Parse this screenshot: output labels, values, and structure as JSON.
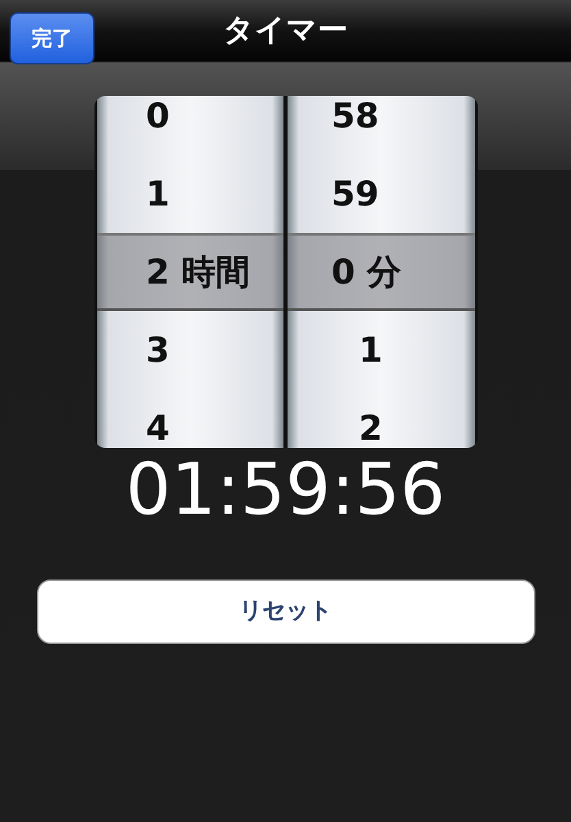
{
  "navbar": {
    "title": "タイマー",
    "done_button": "完了"
  },
  "picker": {
    "columns": [
      {
        "unit": "時間",
        "items": [
          {
            "text": "0",
            "selected": false
          },
          {
            "text": "1",
            "selected": false
          },
          {
            "text": "2",
            "selected": true
          },
          {
            "text": "3",
            "selected": false
          },
          {
            "text": "4",
            "selected": false
          }
        ]
      },
      {
        "unit": "分",
        "items": [
          {
            "text": "58",
            "selected": false
          },
          {
            "text": "59",
            "selected": false
          },
          {
            "text": "0",
            "selected": true
          },
          {
            "text": "1",
            "selected": false
          },
          {
            "text": "2",
            "selected": false
          }
        ]
      }
    ]
  },
  "countdown": "01:59:56",
  "reset_button": "リセット"
}
